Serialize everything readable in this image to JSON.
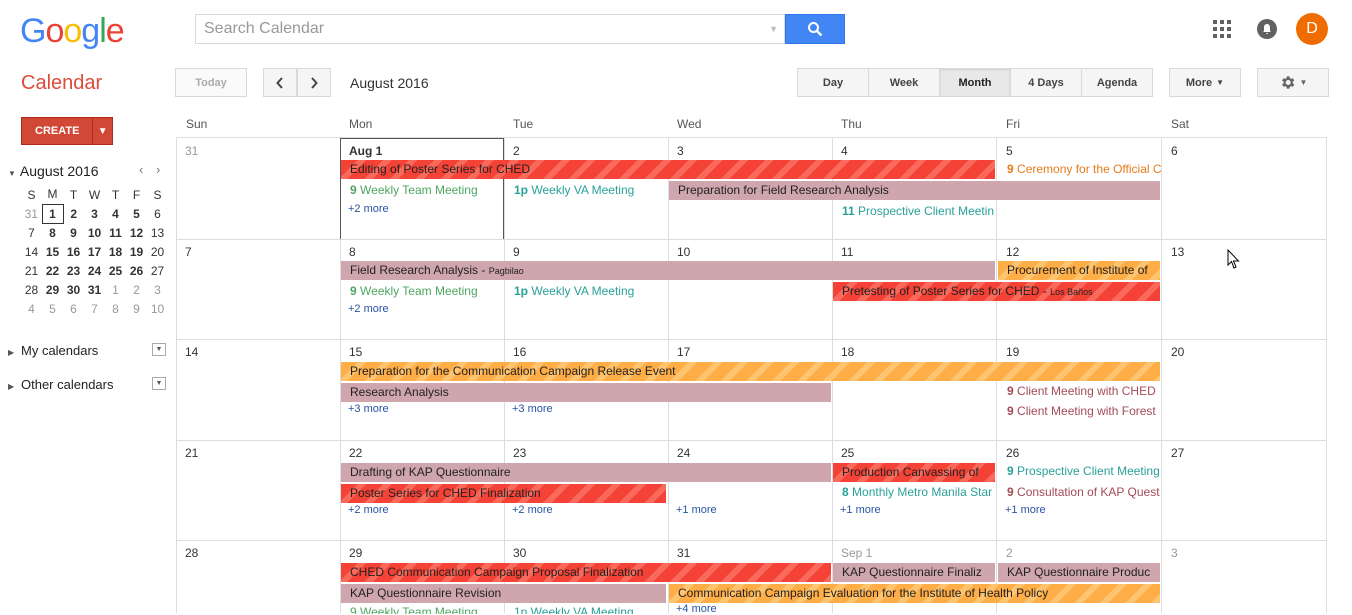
{
  "header": {
    "logo": "Google",
    "search_placeholder": "Search Calendar",
    "avatar_letter": "D"
  },
  "toolbar": {
    "app_title": "Calendar",
    "today": "Today",
    "current_month": "August 2016",
    "views": [
      "Day",
      "Week",
      "Month",
      "4 Days",
      "Agenda"
    ],
    "active_view": "Month",
    "more": "More"
  },
  "sidebar": {
    "create": "CREATE",
    "mini_title": "August 2016",
    "mini_dow": [
      "S",
      "M",
      "T",
      "W",
      "T",
      "F",
      "S"
    ],
    "mini_weeks": [
      [
        "31",
        "1",
        "2",
        "3",
        "4",
        "5",
        "6"
      ],
      [
        "7",
        "8",
        "9",
        "10",
        "11",
        "12",
        "13"
      ],
      [
        "14",
        "15",
        "16",
        "17",
        "18",
        "19",
        "20"
      ],
      [
        "21",
        "22",
        "23",
        "24",
        "25",
        "26",
        "27"
      ],
      [
        "28",
        "29",
        "30",
        "31",
        "1",
        "2",
        "3"
      ],
      [
        "4",
        "5",
        "6",
        "7",
        "8",
        "9",
        "10"
      ]
    ],
    "my_calendars": "My calendars",
    "other_calendars": "Other calendars"
  },
  "grid": {
    "days_of_week": [
      "Sun",
      "Mon",
      "Tue",
      "Wed",
      "Thu",
      "Fri",
      "Sat"
    ],
    "weeks": [
      [
        "31",
        "Aug 1",
        "2",
        "3",
        "4",
        "5",
        "6"
      ],
      [
        "7",
        "8",
        "9",
        "10",
        "11",
        "12",
        "13"
      ],
      [
        "14",
        "15",
        "16",
        "17",
        "18",
        "19",
        "20"
      ],
      [
        "21",
        "22",
        "23",
        "24",
        "25",
        "26",
        "27"
      ],
      [
        "28",
        "29",
        "30",
        "31",
        "Sep 1",
        "2",
        "3"
      ]
    ]
  },
  "events": {
    "w1_editing": "Editing of Poster Series for CHED",
    "w1_ceremony_time": "9",
    "w1_ceremony": "Ceremony for the Official C",
    "w1_team_time": "9",
    "w1_team": "Weekly Team Meeting",
    "w1_va_time": "1p",
    "w1_va": "Weekly VA Meeting",
    "w1_prep_field": "Preparation for Field Research Analysis",
    "w1_prospect_time": "11",
    "w1_prospect": "Prospective Client Meetin",
    "w1_more": "+2 more",
    "w2_field": "Field Research Analysis - ",
    "w2_field_loc": "Pagbilao",
    "w2_procure": "Procurement of Institute of",
    "w2_team_time": "9",
    "w2_team": "Weekly Team Meeting",
    "w2_va_time": "1p",
    "w2_va": "Weekly VA Meeting",
    "w2_pretest": "Pretesting of Poster Series for CHED - ",
    "w2_pretest_loc": "Los Baños",
    "w2_more": "+2 more",
    "w3_prep_comm": "Preparation for the Communication Campaign Release Event",
    "w3_research": "Research Analysis",
    "w3_client_ched_time": "9",
    "w3_client_ched": "Client Meeting with CHED",
    "w3_client_forest_time": "9",
    "w3_client_forest": "Client Meeting with Forest",
    "w3_more1": "+3 more",
    "w3_more2": "+3 more",
    "w4_drafting": "Drafting of KAP Questionnaire",
    "w4_production": "Production Canvassing of",
    "w4_prospect_time": "9",
    "w4_prospect": "Prospective Client Meeting",
    "w4_poster_final": "Poster Series for CHED Finalization",
    "w4_metro_time": "8",
    "w4_metro": "Monthly Metro Manila Star",
    "w4_consult_time": "9",
    "w4_consult": "Consultation of KAP Quest",
    "w4_more_mon": "+2 more",
    "w4_more_tue": "+2 more",
    "w4_more_wed": "+1 more",
    "w4_more_thu": "+1 more",
    "w4_more_fri": "+1 more",
    "w5_ched_prop": "CHED Communication Campaign Proposal Finalization",
    "w5_kap_final": "KAP Questionnaire Finaliz",
    "w5_kap_prod": "KAP Questionnaire Produc",
    "w5_kap_rev": "KAP Questionnaire Revision",
    "w5_comm_eval": "Communication Campaign Evaluation for the Institute of Health Policy",
    "w5_team": "9 Weekly Team Meeting",
    "w5_va": "1p Weekly VA Meeting",
    "w5_more": "+4 more"
  },
  "colors": {
    "brand_red": "#dd4b39",
    "create_bg": "#d14836",
    "search_blue": "#4285f4",
    "event_red": "#f44336",
    "event_orange": "#ffad46",
    "event_pink": "#cfa5ae",
    "avatar": "#ef6c00"
  }
}
